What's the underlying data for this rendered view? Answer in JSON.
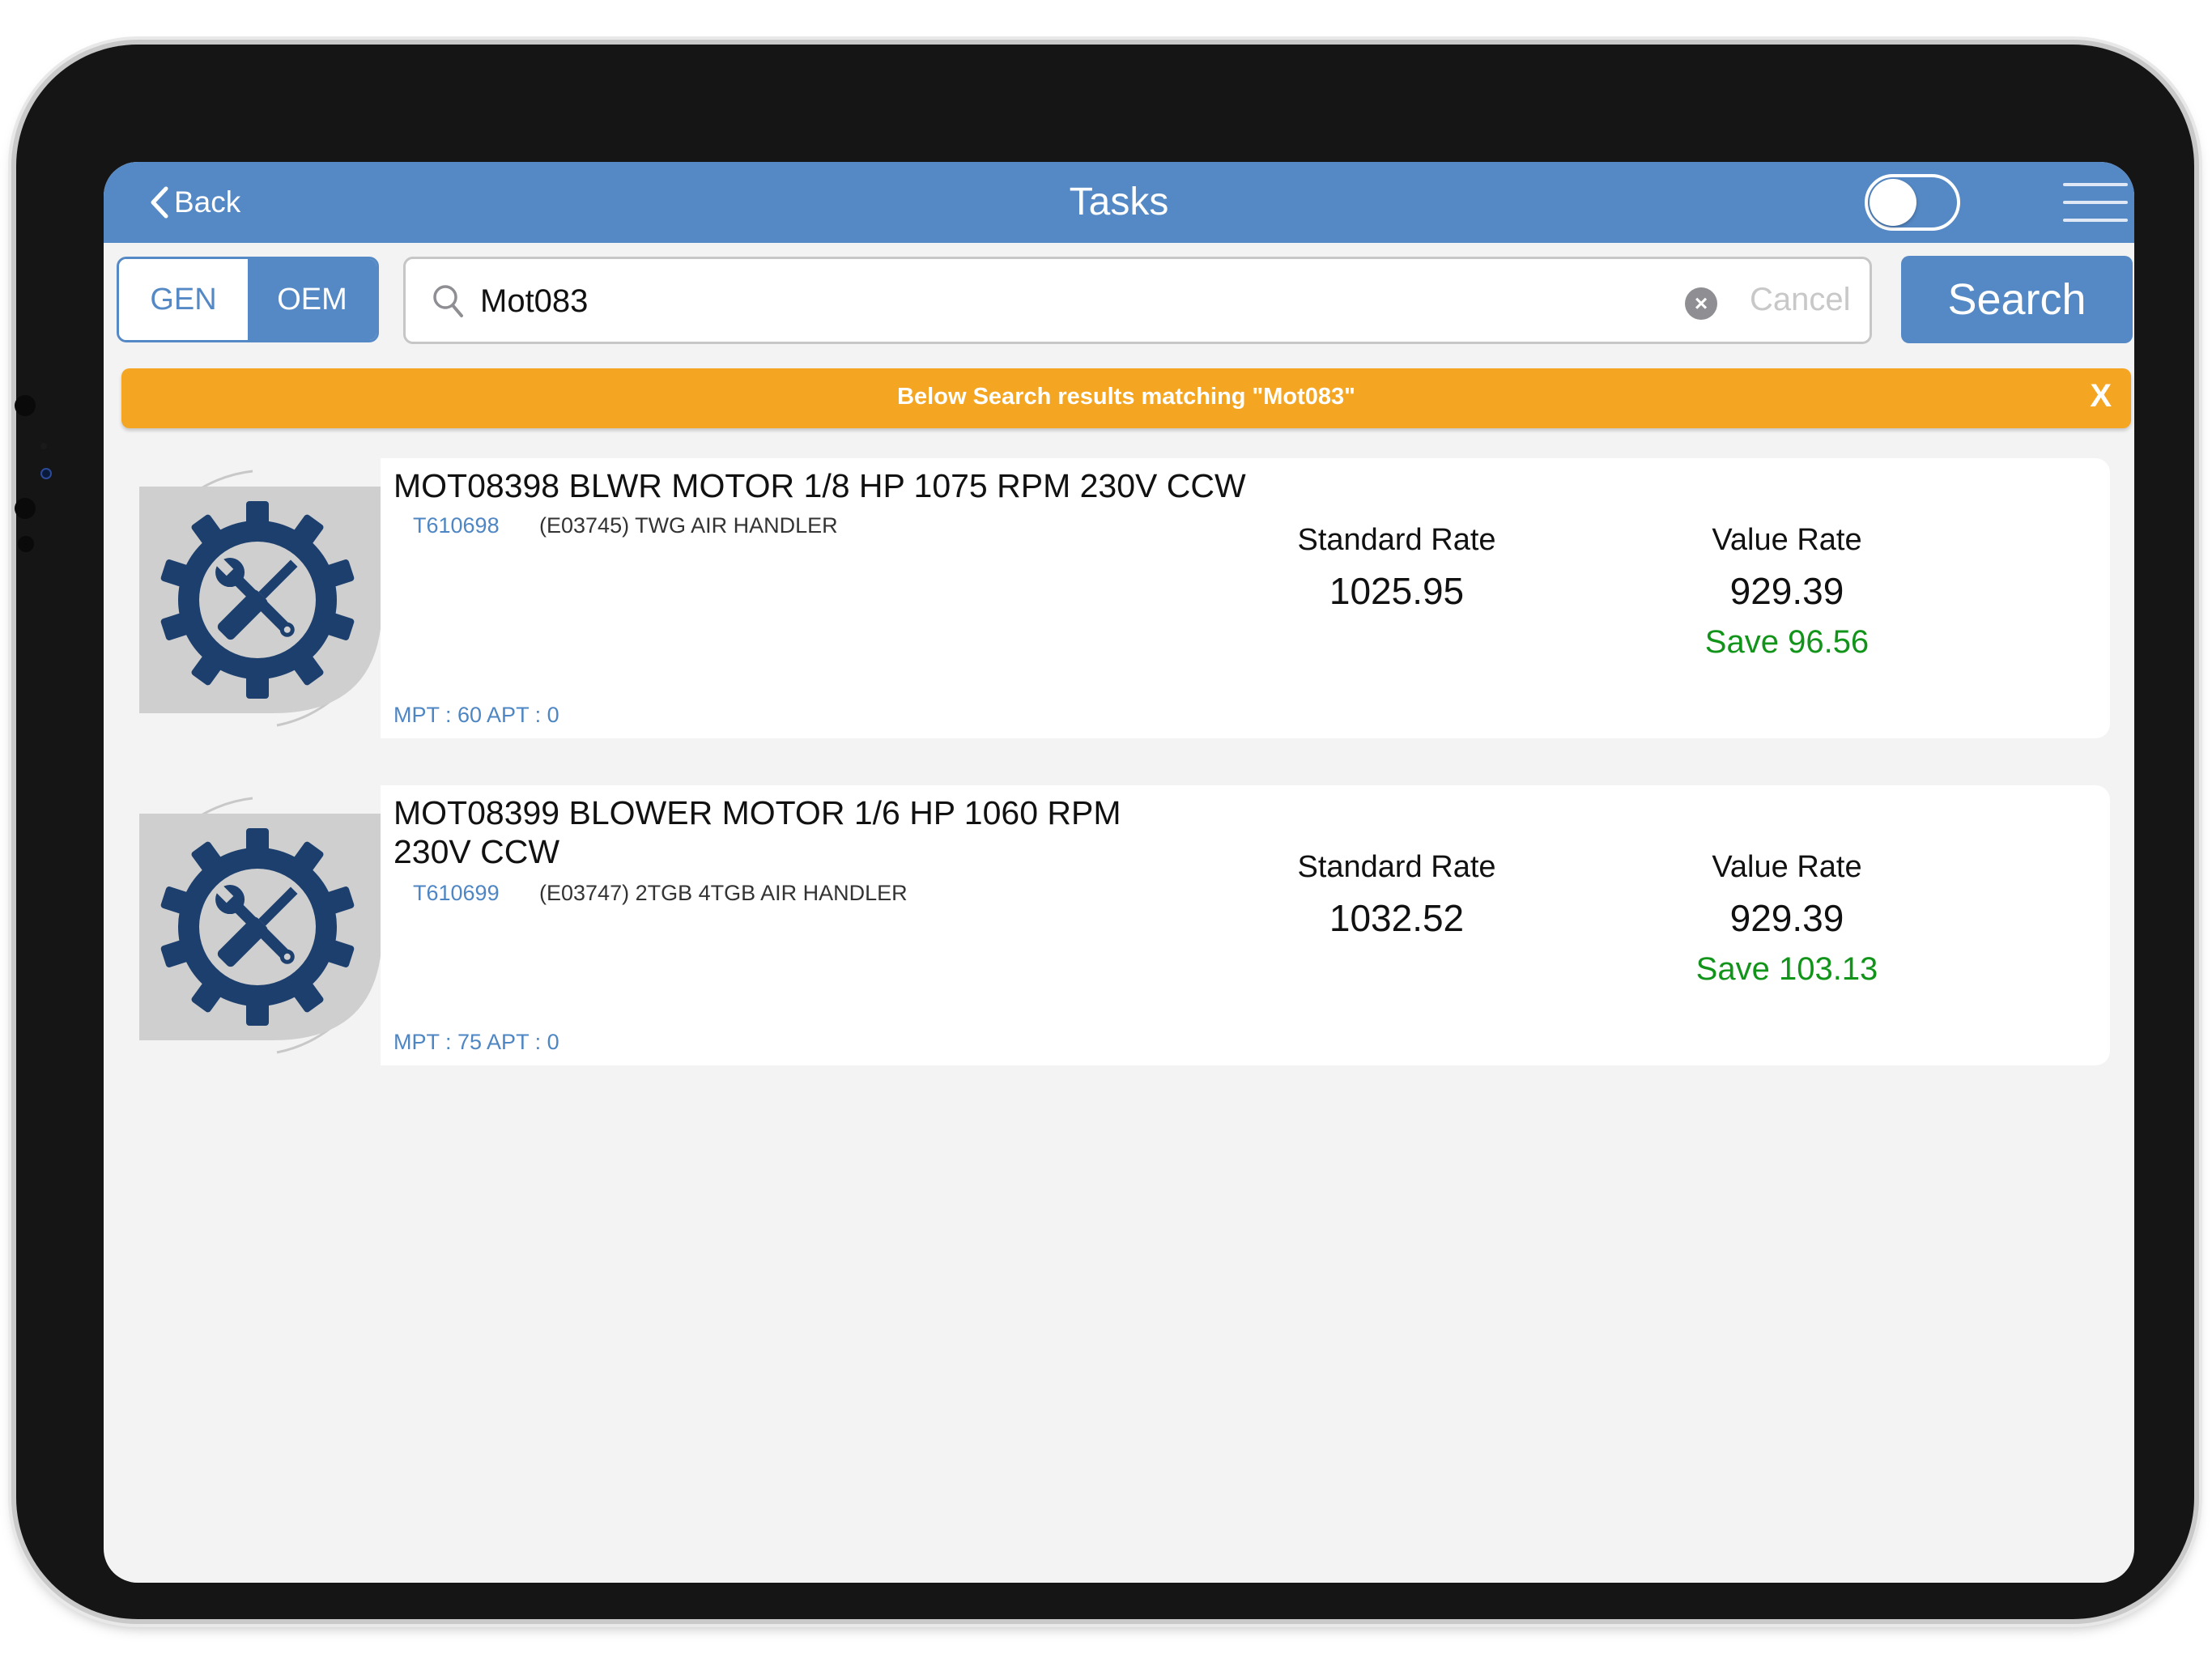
{
  "header": {
    "back_label": "Back",
    "title": "Tasks"
  },
  "segment": {
    "gen_label": "GEN",
    "oem_label": "OEM",
    "selected": "OEM"
  },
  "search": {
    "value": "Mot083",
    "cancel_label": "Cancel",
    "button_label": "Search"
  },
  "banner": {
    "message": "Below Search results matching \"Mot083\"",
    "close_label": "X",
    "color": "#f4a623"
  },
  "results": [
    {
      "name": "MOT08398 BLWR MOTOR 1/8 HP 1075 RPM 230V CCW",
      "code": "T610698",
      "description": "(E03745) TWG AIR HANDLER",
      "mpt": "MPT : 60  APT : 0",
      "standard_rate_label": "Standard Rate",
      "standard_rate": "1025.95",
      "value_rate_label": "Value Rate",
      "value_rate": "929.39",
      "save": "Save 96.56",
      "icon": "gear-tools-icon"
    },
    {
      "name": "MOT08399 BLOWER MOTOR 1/6 HP 1060 RPM 230V CCW",
      "code": "T610699",
      "description": "(E03747) 2TGB 4TGB AIR HANDLER",
      "mpt": "MPT : 75  APT : 0",
      "standard_rate_label": "Standard Rate",
      "standard_rate": "1032.52",
      "value_rate_label": "Value Rate",
      "value_rate": "929.39",
      "save": "Save 103.13",
      "icon": "gear-tools-icon"
    }
  ],
  "colors": {
    "header": "#5589c5",
    "accent_blue": "#4e86c4",
    "save_green": "#12941b"
  }
}
